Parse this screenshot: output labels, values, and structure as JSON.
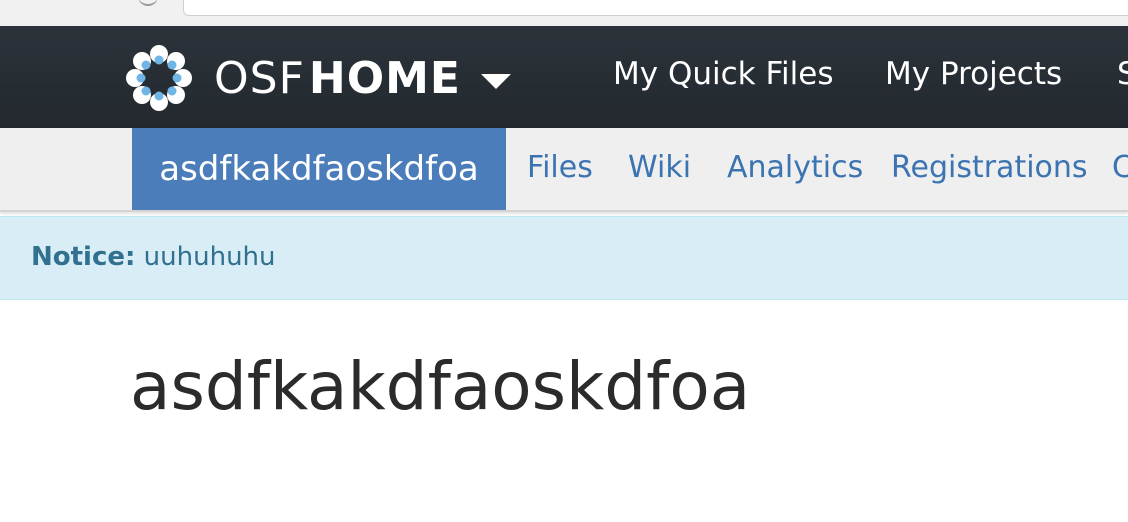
{
  "navbar": {
    "brand_osf": "OSF",
    "brand_home": "HOME",
    "links": [
      "My Quick Files",
      "My Projects",
      "S"
    ]
  },
  "project_nav": {
    "active_title": "asdfkakdfaoskdfoa",
    "links": [
      "Files",
      "Wiki",
      "Analytics",
      "Registrations",
      "C"
    ]
  },
  "notice": {
    "label": "Notice:",
    "message": "uuhuhuhu"
  },
  "page": {
    "title": "asdfkakdfaoskdfoa"
  },
  "icons": {
    "logo": "osf-logo-icon",
    "dropdown": "caret-down-icon"
  },
  "colors": {
    "navbar_bg": "#263238",
    "active_tab_bg": "#4a7dba",
    "subnav_link": "#3b74b1",
    "notice_bg": "#d9edf7",
    "notice_text": "#31708f"
  }
}
